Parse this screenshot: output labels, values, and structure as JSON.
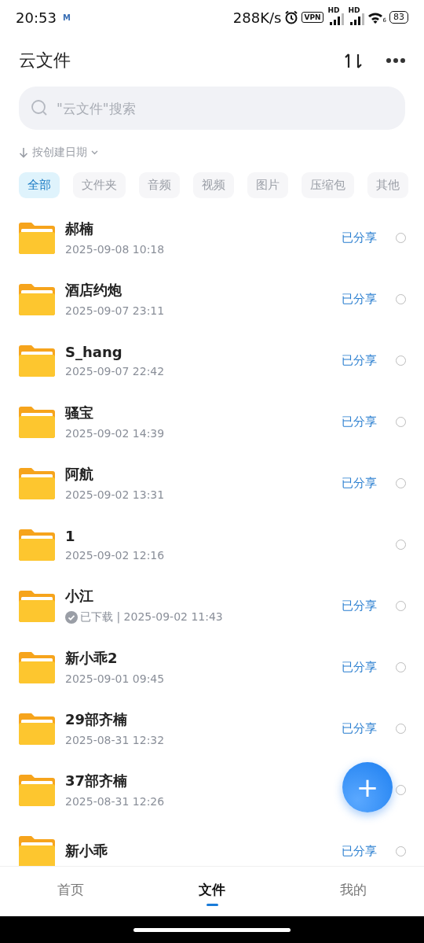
{
  "status_bar": {
    "time": "20:53",
    "notification": "M",
    "speed": "288K/s",
    "vpn": "VPN",
    "signals": [
      {
        "label": "HD"
      },
      {
        "label": "HD"
      }
    ],
    "wifi_label": "6",
    "battery": "83"
  },
  "header": {
    "title": "云文件"
  },
  "search": {
    "placeholder": "\"云文件\"搜索"
  },
  "sort": {
    "label": "按创建日期"
  },
  "filters": [
    {
      "label": "全部",
      "selected": true
    },
    {
      "label": "文件夹",
      "selected": false
    },
    {
      "label": "音频",
      "selected": false
    },
    {
      "label": "视频",
      "selected": false
    },
    {
      "label": "图片",
      "selected": false
    },
    {
      "label": "压缩包",
      "selected": false
    },
    {
      "label": "其他",
      "selected": false
    }
  ],
  "files": [
    {
      "kind": "plain",
      "name": "郝楠",
      "date": "2025-09-08 10:18",
      "status": "已分享",
      "checked": false
    },
    {
      "kind": "plain",
      "name": "酒店约炮",
      "date": "2025-09-07 23:11",
      "status": "已分享",
      "checked": false
    },
    {
      "kind": "plain",
      "name": "S_hang",
      "date": "2025-09-07 22:42",
      "status": "已分享",
      "checked": false
    },
    {
      "kind": "plain",
      "name": "骚宝",
      "date": "2025-09-02 14:39",
      "status": "已分享",
      "checked": false
    },
    {
      "kind": "plain",
      "name": "阿航",
      "date": "2025-09-02 13:31",
      "status": "已分享",
      "checked": false
    },
    {
      "kind": "plain",
      "name": "1",
      "date": "2025-09-02 12:16",
      "checked": false
    },
    {
      "kind": "downloaded",
      "name": "小江",
      "date": "已下载 | 2025-09-02 11:43",
      "status": "已分享",
      "checked": false
    },
    {
      "kind": "plain",
      "name": "新小乖2",
      "date": "2025-09-01 09:45",
      "status": "已分享",
      "checked": false
    },
    {
      "kind": "plain",
      "name": "29部齐楠",
      "date": "2025-08-31 12:32",
      "status": "已分享",
      "checked": false
    },
    {
      "kind": "plain",
      "name": "37部齐楠",
      "date": "2025-08-31 12:26",
      "checked": false
    },
    {
      "kind": "plain",
      "name": "新小乖",
      "status": "已分享",
      "checked": false
    }
  ],
  "fab": {
    "label": "+"
  },
  "bottom_nav": [
    {
      "label": "首页",
      "selected": false
    },
    {
      "label": "文件",
      "selected": true
    },
    {
      "label": "我的",
      "selected": false
    }
  ]
}
